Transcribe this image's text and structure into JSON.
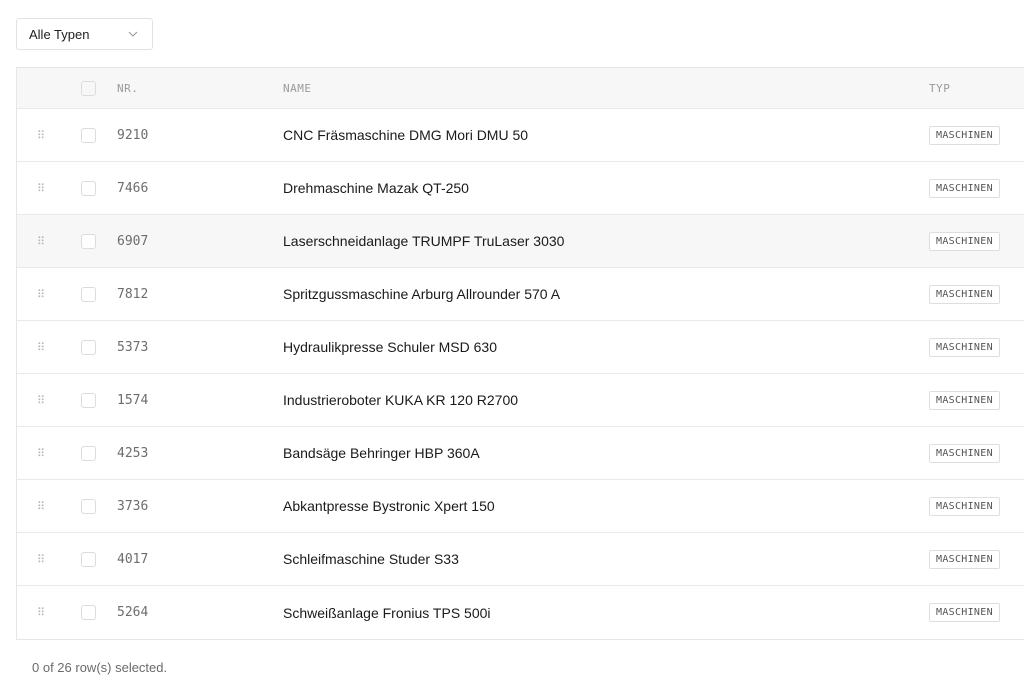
{
  "filter": {
    "selected": "Alle Typen",
    "icon": "chevron-down-icon"
  },
  "table": {
    "headers": {
      "nr": "NR.",
      "name": "NAME",
      "type": "TYP"
    },
    "rows": [
      {
        "nr": "9210",
        "name": "CNC Fräsmaschine DMG Mori DMU 50",
        "type": "MASCHINEN"
      },
      {
        "nr": "7466",
        "name": "Drehmaschine Mazak QT-250",
        "type": "MASCHINEN"
      },
      {
        "nr": "6907",
        "name": "Laserschneidanlage TRUMPF TruLaser 3030",
        "type": "MASCHINEN"
      },
      {
        "nr": "7812",
        "name": "Spritzgussmaschine Arburg Allrounder 570 A",
        "type": "MASCHINEN"
      },
      {
        "nr": "5373",
        "name": "Hydraulikpresse Schuler MSD 630",
        "type": "MASCHINEN"
      },
      {
        "nr": "1574",
        "name": "Industrieroboter KUKA KR 120 R2700",
        "type": "MASCHINEN"
      },
      {
        "nr": "4253",
        "name": "Bandsäge Behringer HBP 360A",
        "type": "MASCHINEN"
      },
      {
        "nr": "3736",
        "name": "Abkantpresse Bystronic Xpert 150",
        "type": "MASCHINEN"
      },
      {
        "nr": "4017",
        "name": "Schleifmaschine Studer S33",
        "type": "MASCHINEN"
      },
      {
        "nr": "5264",
        "name": "Schweißanlage Fronius TPS 500i",
        "type": "MASCHINEN"
      }
    ]
  },
  "footer": {
    "selection_text": "0 of 26 row(s) selected."
  },
  "colors": {
    "header_bg": "#f7f7f7",
    "border": "#e6e6e6",
    "text_muted": "#6d6d6d"
  }
}
